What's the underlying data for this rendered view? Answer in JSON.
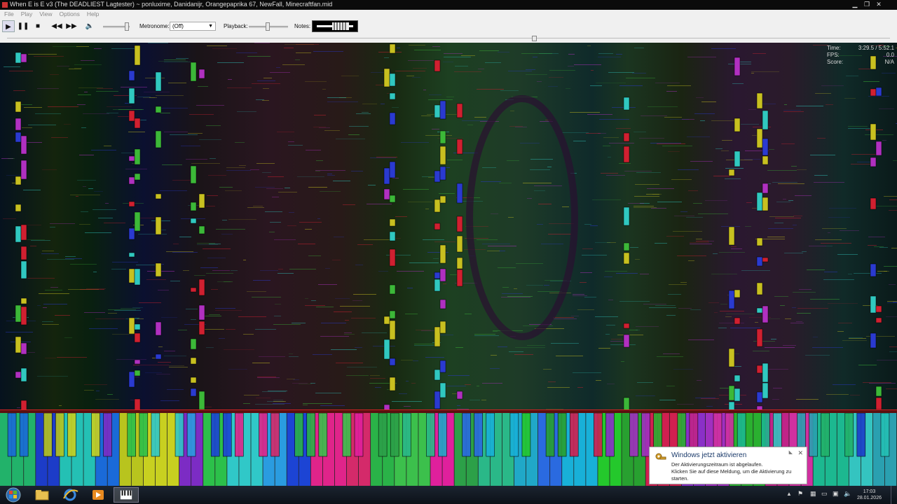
{
  "window": {
    "title": "When E is E v3 (The DEADLIEST Lagtester) ~ ponluxime, Danidanijr, Orangepaprika 67, NewFall, Minecraftfan.mid",
    "controls": [
      "minimize-icon",
      "maximize-icon",
      "close-icon"
    ]
  },
  "menu": [
    "File",
    "Play",
    "View",
    "Options",
    "Help"
  ],
  "toolbar": {
    "metronome_label": "Metronome:",
    "metronome_value": "(Off)",
    "playback_label": "Playback:",
    "notes_label": "Notes:"
  },
  "stats": {
    "time_label": "Time:",
    "time_value": "3:29.5 / 5:52.1",
    "fps_label": "FPS:",
    "fps_value": "0.0",
    "score_label": "Score:",
    "score_value": "N/A"
  },
  "keyboard": {
    "key_colors": [
      "#22b26a",
      "#1c3cc8",
      "#24c0b4",
      "#1a6ad8",
      "#b8c41e",
      "#c8d020",
      "#7c2cc4",
      "#2cc04a",
      "#30c8c8",
      "#2a9ce0",
      "#1c44d4",
      "#e0248a",
      "#d42a6a",
      "#2ab248",
      "#3cc04c",
      "#e0209c",
      "#2ca048",
      "#2ab888",
      "#20a8c8",
      "#2a6ae0",
      "#18b0d8",
      "#24c82c",
      "#28a030",
      "#d02050",
      "#8a30c8",
      "#a030c0",
      "#2ab030",
      "#c02488",
      "#d030a0",
      "#1cb890",
      "#34c4c0",
      "#2aa0b0"
    ]
  },
  "taskbar": {
    "items": [
      "start-orb",
      "explorer",
      "internet-explorer",
      "media-player",
      "pianofrommidi"
    ],
    "clock_time": "17:03",
    "clock_date": "28.01.2026"
  },
  "notification": {
    "title": "Windows jetzt aktivieren",
    "line1": "Der Aktivierungszeitraum ist abgelaufen.",
    "line2": "Klicken Sie auf diese Meldung, um die Aktivierung zu starten."
  },
  "colors": {
    "accent_red": "#cc2222",
    "note_cyan": "#30c8c0",
    "note_yellow": "#c8c020",
    "note_blue": "#2a3ad0",
    "note_red": "#d02030",
    "note_magenta": "#b030c0",
    "note_green": "#3cb838"
  }
}
